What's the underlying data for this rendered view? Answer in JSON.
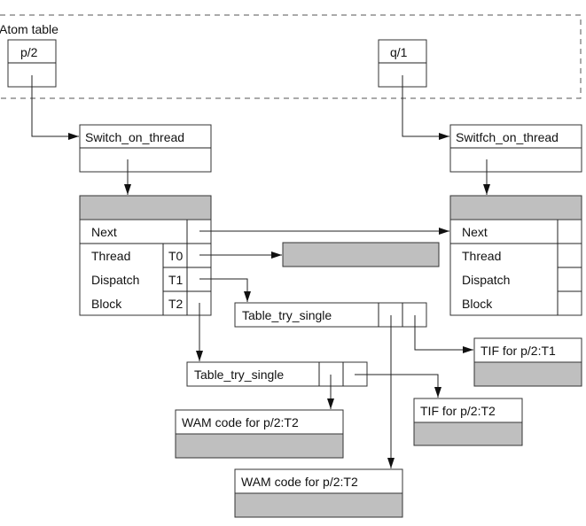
{
  "atom_table": {
    "label": "Atom table",
    "entries": [
      {
        "name": "p/2"
      },
      {
        "name": "q/1"
      }
    ]
  },
  "switch_boxes": {
    "left": "Switch_on_thread",
    "right": "Switfch_on_thread"
  },
  "thread_tables": {
    "left": {
      "rows": [
        "Next",
        "Thread",
        "Dispatch",
        "Block"
      ],
      "tags": [
        "T0",
        "T1",
        "T2"
      ]
    },
    "right": {
      "rows": [
        "Next",
        "Thread",
        "Dispatch",
        "Block"
      ]
    }
  },
  "try_tables": {
    "upper": "Table_try_single",
    "lower": "Table_try_single"
  },
  "code_blocks": {
    "tif_t1": "TIF for p/2:T1",
    "tif_t2": "TIF for p/2:T2",
    "wam_lower": "WAM code for p/2:T2",
    "wam_bottom": "WAM code for p/2:T2"
  },
  "colors": {
    "fill_gray": "#bfbfbf",
    "stroke": "#333333"
  }
}
